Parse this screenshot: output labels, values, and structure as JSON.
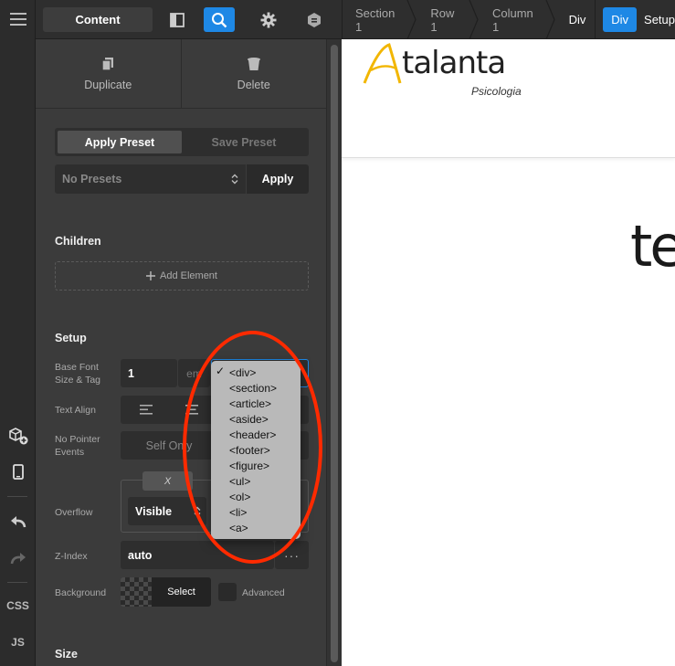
{
  "rail": {
    "css": "CSS",
    "js": "JS"
  },
  "topbar": {
    "content_tab": "Content",
    "breadcrumbs": [
      "Section 1",
      "Row 1",
      "Column 1",
      "Div"
    ],
    "active_crumb": "Div",
    "trailing": "Setup",
    "accent": "#1e88e5"
  },
  "panel": {
    "actions": {
      "duplicate": "Duplicate",
      "delete": "Delete"
    },
    "preset": {
      "apply_tab": "Apply Preset",
      "save_tab": "Save Preset",
      "select_value": "No Presets",
      "apply_button": "Apply"
    },
    "children": {
      "title": "Children",
      "add_element": "Add Element"
    },
    "setup": {
      "title": "Setup",
      "base_font_label": "Base Font Size & Tag",
      "base_font_value": "1",
      "base_font_unit": "em",
      "text_align_label": "Text Align",
      "pointer_label": "No Pointer Events",
      "pointer_value": "Self Only",
      "overflow_label": "Overflow",
      "overflow_x_tab": "X",
      "overflow_value": "Visible",
      "zindex_label": "Z-Index",
      "zindex_value": "auto",
      "background_label": "Background",
      "background_select": "Select",
      "background_advanced": "Advanced"
    },
    "size_title": "Size"
  },
  "dropdown": {
    "selected": "<div>",
    "options": [
      "<div>",
      "<section>",
      "<article>",
      "<aside>",
      "<header>",
      "<footer>",
      "<figure>",
      "<ul>",
      "<ol>",
      "<li>",
      "<a>"
    ]
  },
  "canvas": {
    "logo_text": "talanta",
    "logo_sub": "Psicologia",
    "big_text": "te"
  },
  "colors": {
    "annotation": "#ff2a00",
    "panel_bg": "#3b3b3b"
  }
}
